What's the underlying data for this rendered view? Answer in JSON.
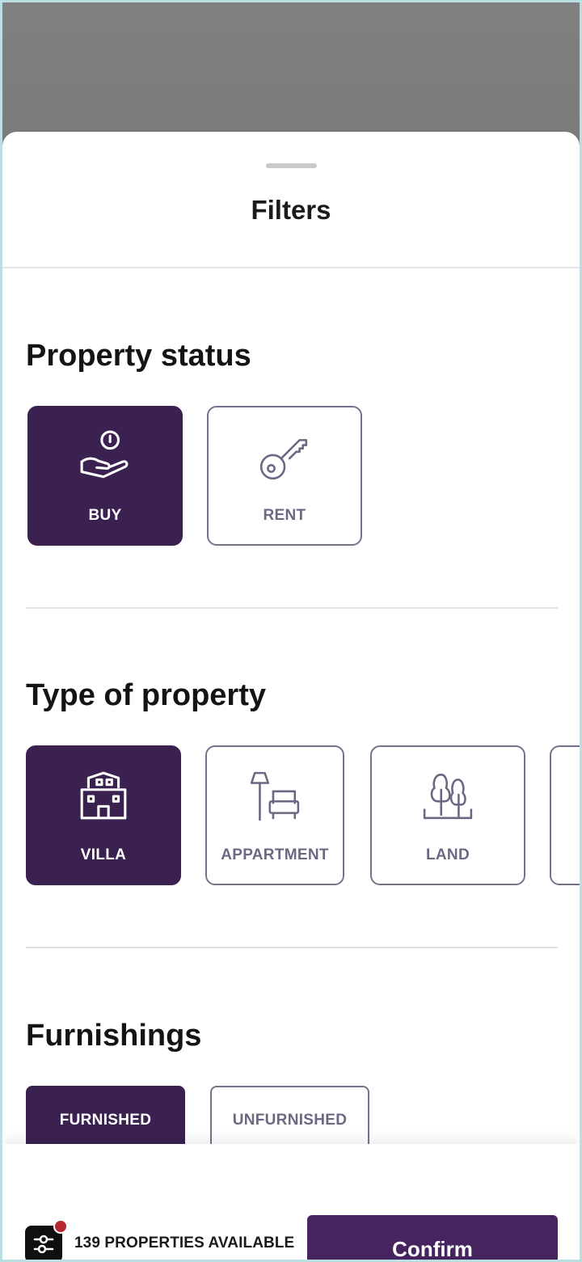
{
  "sheet": {
    "title": "Filters"
  },
  "property_status": {
    "title": "Property status",
    "options": [
      {
        "label": "BUY",
        "icon": "hand-coin-icon",
        "selected": true
      },
      {
        "label": "RENT",
        "icon": "key-icon",
        "selected": false
      }
    ]
  },
  "property_type": {
    "title": "Type of property",
    "options": [
      {
        "label": "VILLA",
        "icon": "villa-icon",
        "selected": true
      },
      {
        "label": "APPARTMENT",
        "icon": "lamp-armchair-icon",
        "selected": false
      },
      {
        "label": "LAND",
        "icon": "trees-icon",
        "selected": false
      }
    ]
  },
  "furnishings": {
    "title": "Furnishings",
    "options": [
      {
        "label": "FURNISHED",
        "selected": true
      },
      {
        "label": "UNFURNISHED",
        "selected": false
      }
    ]
  },
  "footer": {
    "available_text": "139 PROPERTIES AVAILABLE",
    "confirm_label": "Confirm",
    "badge_icon": "sliders-icon"
  },
  "colors": {
    "accent": "#3b2150",
    "confirm": "#45245f",
    "outline": "#77728c",
    "badge_dot": "#b8262f"
  }
}
